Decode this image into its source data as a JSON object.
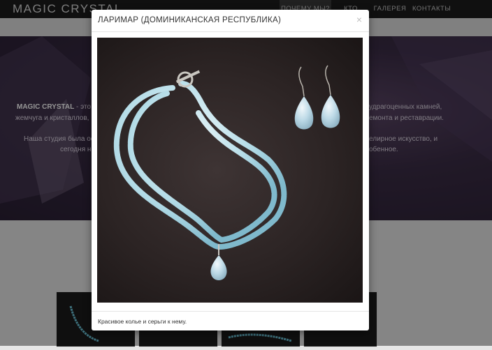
{
  "navbar": {
    "brand": "MAGIC CRYSTAL",
    "items": [
      {
        "label": "ПОЧЕМУ МЫ?",
        "active": true
      },
      {
        "label": "КТО МЫ?",
        "active": false
      },
      {
        "label": "ГАЛЕРЕЯ",
        "active": false
      },
      {
        "label": "КОНТАКТЫ",
        "active": false
      }
    ]
  },
  "hero": {
    "line1_brand": "MAGIC CRYSTAL",
    "line1_rest": " - это",
    "line2_left": "жемчуга и кристаллов,",
    "line3_left": "Наша студия была ос",
    "line4_left": "сегодня н",
    "line1_right": "удрагоценных камней,",
    "line2_right": "емонта и реставрации.",
    "line3_right": "елирное искусство, и",
    "line4_right": "обенное."
  },
  "modal": {
    "title": "ЛАРИМАР (ДОМИНИКАНСКАЯ РЕСПУБЛИКА)",
    "close_icon": "×",
    "caption": "Красивое колье и серьги к нему."
  },
  "colors": {
    "navbar": "#1c1c1c",
    "hero": "#3a2c45",
    "larimar": "#a8d8e6"
  }
}
